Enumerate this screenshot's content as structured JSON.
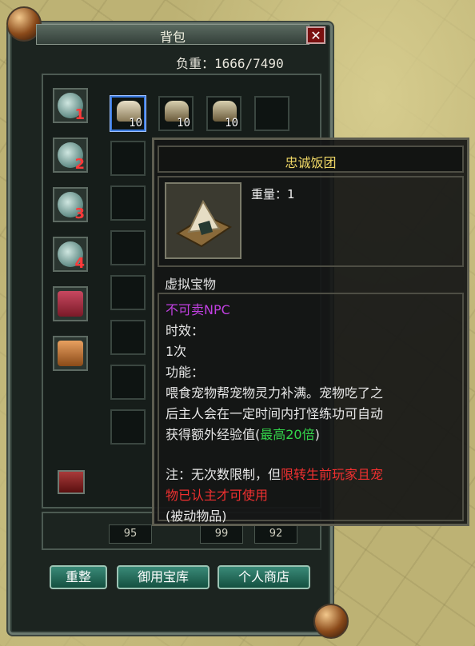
{
  "window": {
    "title": "背包",
    "close_label": "✕",
    "weight_label": "负重：1666/7490"
  },
  "tabs": [
    {
      "label": "1",
      "icon": "pet-tab-icon"
    },
    {
      "label": "2",
      "icon": "pet-tab-icon"
    },
    {
      "label": "3",
      "icon": "pet-tab-icon"
    },
    {
      "label": "4",
      "icon": "pet-tab-icon"
    },
    {
      "label": "",
      "icon": "outfit-tab-icon"
    },
    {
      "label": "",
      "icon": "mount-tab-icon"
    }
  ],
  "inventory": {
    "items": [
      {
        "qty": "10",
        "icon": "onigiri-icon"
      },
      {
        "qty": "10",
        "icon": "helmet-icon"
      },
      {
        "qty": "10",
        "icon": "helmet-icon"
      }
    ],
    "money": [
      "95",
      "99",
      "92"
    ]
  },
  "buttons": {
    "sort": "重整",
    "vault": "御用宝库",
    "shop": "个人商店"
  },
  "tooltip": {
    "name": "忠诚饭团",
    "weight": "重量：1",
    "type": "虚拟宝物",
    "not_sellable": "不可卖NPC",
    "duration_label": "时效：",
    "duration_value": "1次",
    "function_label": "功能：",
    "desc_1": "喂食宠物帮宠物灵力补满。宠物吃了之",
    "desc_2": "后主人会在一定时间内打怪练功可自动",
    "desc_3a": "获得额外经验值(",
    "desc_3b": "最高20倍",
    "desc_3c": ")",
    "note_a": "注：无次数限制，但",
    "note_b": "限转生前玩家且宠",
    "note_c": "物已认主才可使用",
    "passive": "(被动物品)"
  },
  "colors": {
    "title_gold": "#f0d866",
    "purple": "#c040e0",
    "green": "#33d54a",
    "red": "#f03030"
  }
}
